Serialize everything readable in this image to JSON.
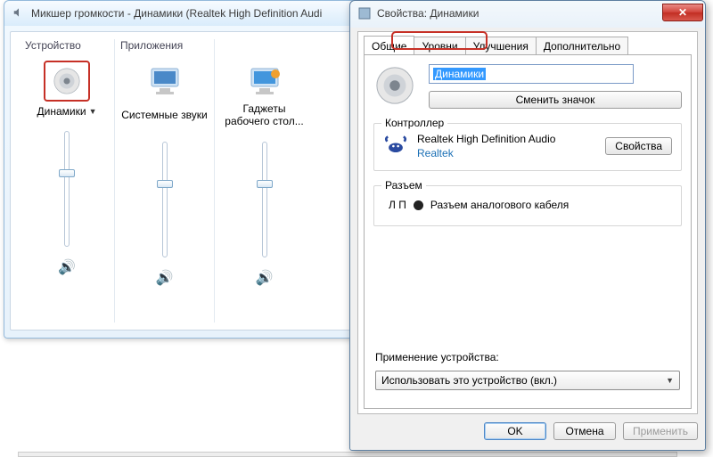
{
  "mixer": {
    "title": "Микшер громкости - Динамики (Realtek High Definition Audi",
    "device_section": "Устройство",
    "apps_section": "Приложения",
    "device_name": "Динамики",
    "columns": [
      {
        "label": "Динамики",
        "slider_pos": 0.62
      },
      {
        "label": "Системные звуки",
        "slider_pos": 0.62
      },
      {
        "label": "Гаджеты рабочего стол...",
        "slider_pos": 0.62
      }
    ]
  },
  "props": {
    "title": "Свойства: Динамики",
    "tabs": [
      "Общие",
      "Уровни",
      "Улучшения",
      "Дополнительно"
    ],
    "active_tab": 0,
    "device_name": "Динамики",
    "change_icon_btn": "Сменить значок",
    "controller_group": "Контроллер",
    "controller_name": "Realtek High Definition Audio",
    "controller_vendor": "Realtek",
    "properties_btn": "Свойства",
    "jack_group": "Разъем",
    "jack_side": "Л П",
    "jack_label": "Разъем аналогового кабеля",
    "usage_label": "Применение устройства:",
    "usage_value": "Использовать это устройство (вкл.)",
    "ok": "OK",
    "cancel": "Отмена",
    "apply": "Применить"
  }
}
